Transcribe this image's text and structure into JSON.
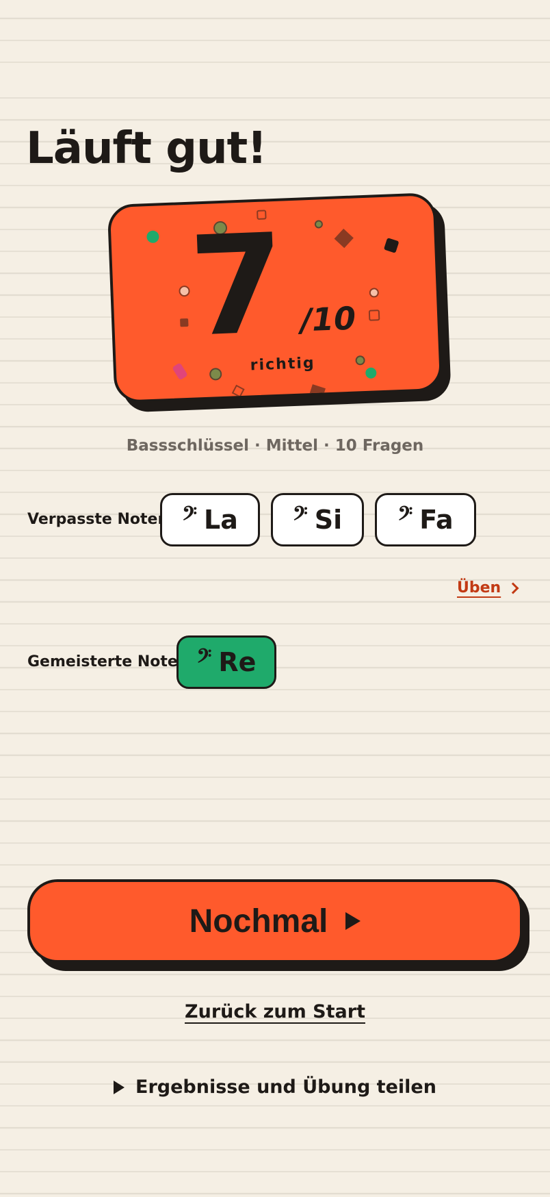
{
  "header": {
    "title": "Läuft gut!"
  },
  "score": {
    "correct": "7",
    "total": "/10",
    "label": "richtig"
  },
  "quiz_info": "Bassschlüssel · Mittel · 10 Fragen",
  "missed": {
    "label": "Verpasste Noten",
    "notes": [
      {
        "clef": "𝄢",
        "name": "La"
      },
      {
        "clef": "𝄢",
        "name": "Si"
      },
      {
        "clef": "𝄢",
        "name": "Fa"
      }
    ],
    "practice_label": "Üben"
  },
  "mastered": {
    "label": "Gemeisterte Noten",
    "notes": [
      {
        "clef": "𝄢",
        "name": "Re"
      }
    ]
  },
  "actions": {
    "retry_label": "Nochmal",
    "back_label": "Zurück zum Start",
    "share_label": "Ergebnisse und Übung teilen"
  },
  "colors": {
    "background": "#f5efe4",
    "accent": "#ff5a2c",
    "mastered": "#1faa6b",
    "ink": "#1e1a17",
    "link": "#c23a14"
  },
  "icons": {
    "clef": "bass-clef-icon",
    "retry": "play-icon",
    "practice": "chevron-right-icon",
    "share": "triangle-right-icon"
  }
}
